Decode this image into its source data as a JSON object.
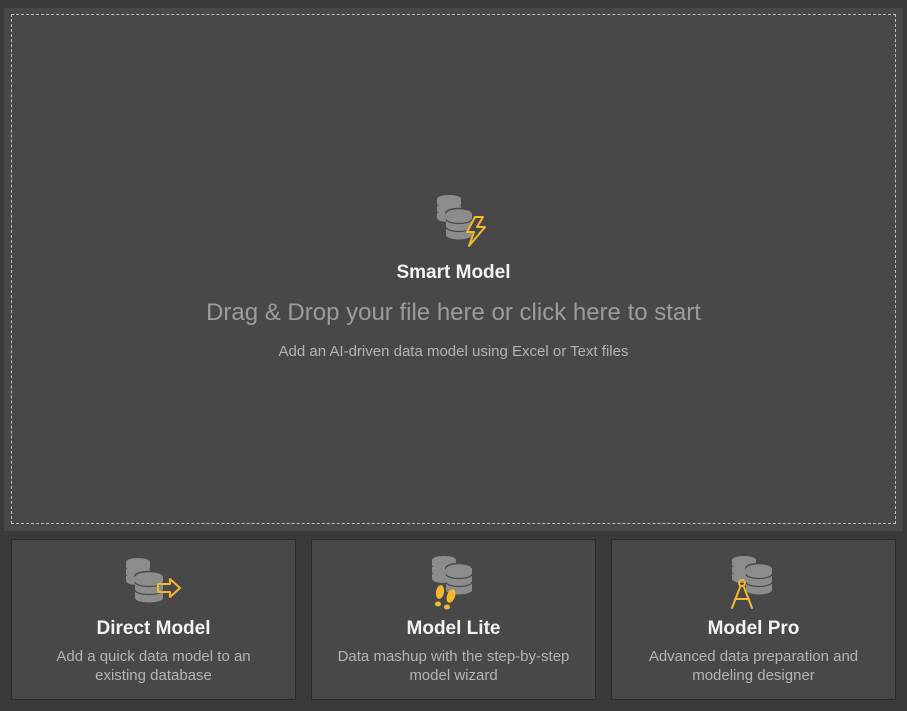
{
  "smart_model": {
    "icon": "database-lightning-icon",
    "title": "Smart Model",
    "drag_text": "Drag & Drop your file here or click here to start",
    "subtitle": "Add an AI-driven data model using Excel or Text files"
  },
  "cards": [
    {
      "icon": "database-arrow-icon",
      "title": "Direct Model",
      "description": "Add a quick data model to an existing database"
    },
    {
      "icon": "database-footsteps-icon",
      "title": "Model Lite",
      "description": "Data mashup with the step-by-step model wizard"
    },
    {
      "icon": "database-compass-icon",
      "title": "Model Pro",
      "description": "Advanced data preparation and modeling designer"
    }
  ],
  "colors": {
    "background": "#3a3a3a",
    "panel": "#484848",
    "accent": "#f5b82e",
    "db_gray": "#8c8c8c",
    "title_text": "#f2f2f2",
    "muted_text": "#9c9c9c"
  }
}
